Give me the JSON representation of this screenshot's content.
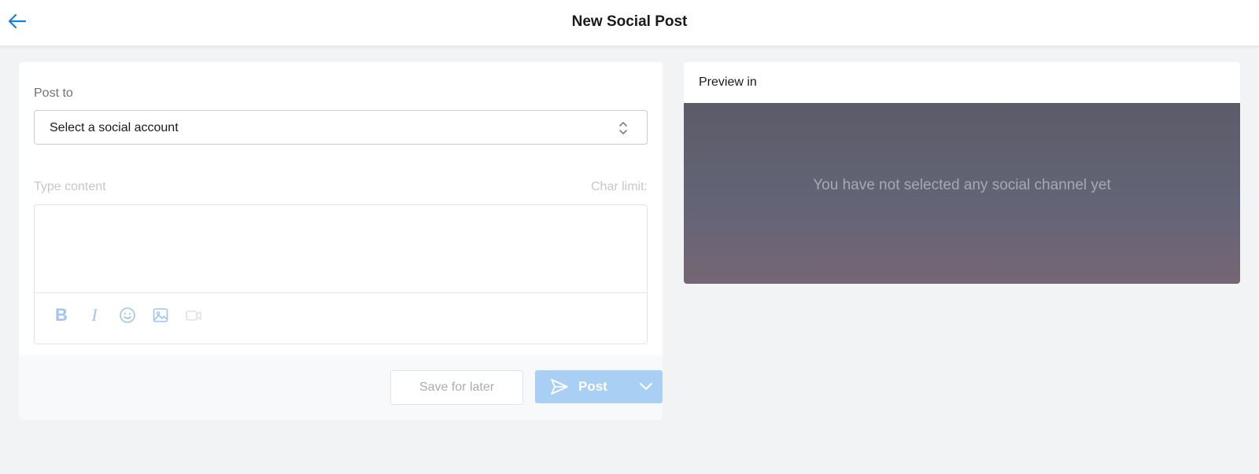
{
  "header": {
    "title": "New Social Post",
    "back_icon": "arrow-left-icon"
  },
  "composer": {
    "post_to_label": "Post to",
    "account_select": {
      "value": "Select a social account"
    },
    "content_label": "Type content",
    "char_limit_label": "Char limit:",
    "editor_value": "",
    "toolbar": [
      "bold-icon",
      "italic-icon",
      "emoji-icon",
      "image-icon",
      "video-icon"
    ]
  },
  "footer": {
    "save_label": "Save for later",
    "post_label": "Post"
  },
  "preview": {
    "title": "Preview in",
    "empty_message": "You have not selected any social channel yet"
  },
  "colors": {
    "accent": "#1a7fd9",
    "post_button_disabled": "#a9cff5",
    "page_bg": "#f2f3f5"
  }
}
